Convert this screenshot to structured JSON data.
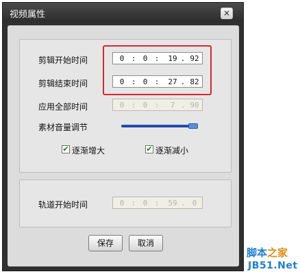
{
  "window": {
    "title": "视频属性",
    "close_label": "×"
  },
  "fields": {
    "clip_start": {
      "label": "剪辑开始时间",
      "h": "0",
      "m": "0",
      "s": "19",
      "f": "92"
    },
    "clip_end": {
      "label": "剪辑结束时间",
      "h": "0",
      "m": "0",
      "s": "27",
      "f": "82"
    },
    "apply_all": {
      "label": "应用全部时间",
      "h": "0",
      "m": "0",
      "s": "7",
      "f": "90"
    },
    "volume": {
      "label": "素材音量调节"
    },
    "fade_in": {
      "label": "逐渐增大",
      "mark": "✔"
    },
    "fade_out": {
      "label": "逐渐减小",
      "mark": "✔"
    },
    "track_start": {
      "label": "轨道开始时间",
      "h": "0",
      "m": "0",
      "s": "59",
      "f": "0"
    }
  },
  "separators": {
    "colon": ":",
    "dot": "."
  },
  "buttons": {
    "save": "保存",
    "cancel": "取消"
  },
  "watermark": {
    "line1_a": "脚本",
    "line1_b": "之家",
    "line2": "JB51.Net"
  },
  "colors": {
    "highlight": "#d8262c",
    "slider": "#2e5cc4"
  }
}
